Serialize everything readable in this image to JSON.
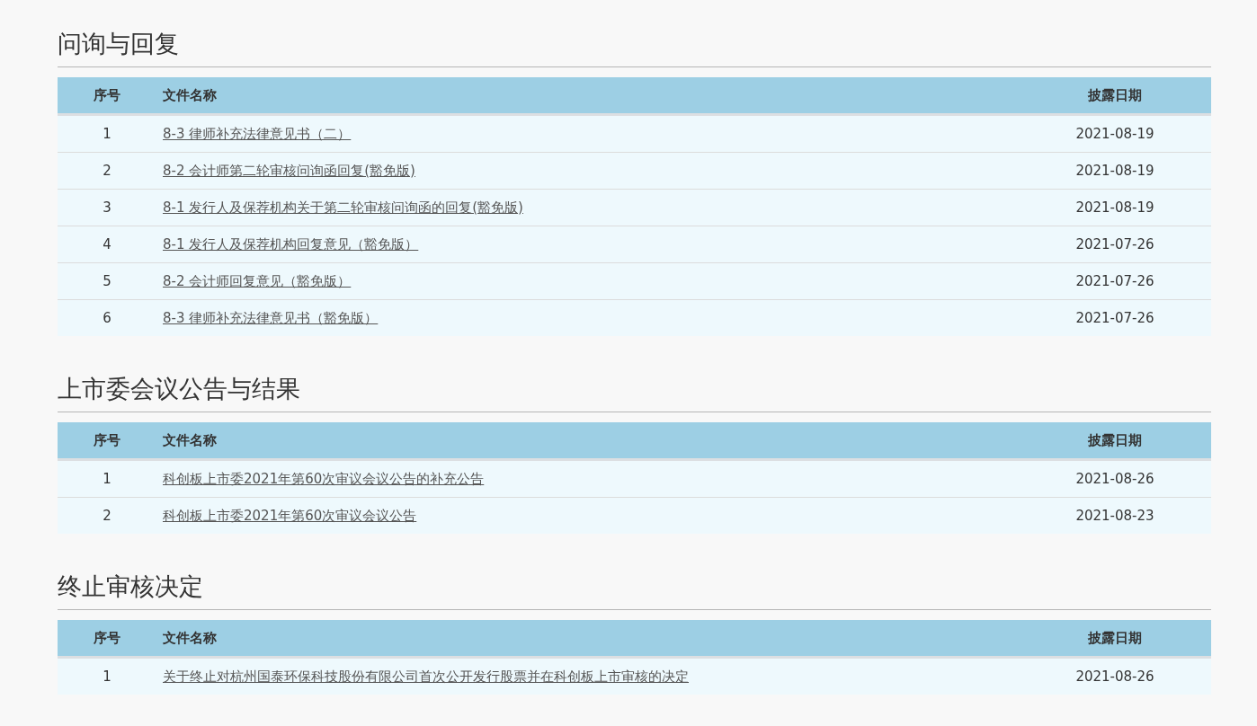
{
  "sections": [
    {
      "title": "问询与回复",
      "columns": [
        "序号",
        "文件名称",
        "披露日期"
      ],
      "rows": [
        {
          "index": "1",
          "name": "8-3 律师补充法律意见书（二）",
          "date": "2021-08-19"
        },
        {
          "index": "2",
          "name": "8-2 会计师第二轮审核问询函回复(豁免版)",
          "date": "2021-08-19"
        },
        {
          "index": "3",
          "name": "8-1 发行人及保荐机构关于第二轮审核问询函的回复(豁免版)",
          "date": "2021-08-19"
        },
        {
          "index": "4",
          "name": "8-1 发行人及保荐机构回复意见（豁免版）",
          "date": "2021-07-26"
        },
        {
          "index": "5",
          "name": "8-2 会计师回复意见（豁免版）",
          "date": "2021-07-26"
        },
        {
          "index": "6",
          "name": "8-3 律师补充法律意见书（豁免版）",
          "date": "2021-07-26"
        }
      ]
    },
    {
      "title": "上市委会议公告与结果",
      "columns": [
        "序号",
        "文件名称",
        "披露日期"
      ],
      "rows": [
        {
          "index": "1",
          "name": "科创板上市委2021年第60次审议会议公告的补充公告",
          "date": "2021-08-26"
        },
        {
          "index": "2",
          "name": "科创板上市委2021年第60次审议会议公告",
          "date": "2021-08-23"
        }
      ]
    },
    {
      "title": "终止审核决定",
      "columns": [
        "序号",
        "文件名称",
        "披露日期"
      ],
      "rows": [
        {
          "index": "1",
          "name": "关于终止对杭州国泰环保科技股份有限公司首次公开发行股票并在科创板上市审核的决定",
          "date": "2021-08-26"
        }
      ]
    }
  ]
}
